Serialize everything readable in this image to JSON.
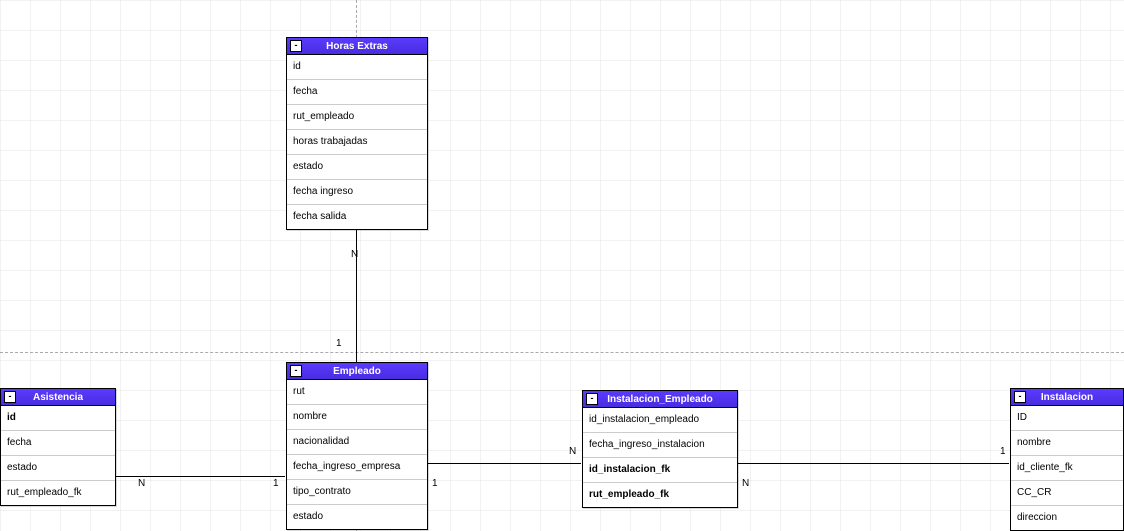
{
  "entities": {
    "horas_extras": {
      "title": "Horas Extras",
      "attrs": [
        "id",
        "fecha",
        "rut_empleado",
        "horas trabajadas",
        "estado",
        "fecha ingreso",
        "fecha salida"
      ]
    },
    "empleado": {
      "title": "Empleado",
      "attrs": [
        "rut",
        "nombre",
        "nacionalidad",
        "fecha_ingreso_empresa",
        "tipo_contrato",
        "estado"
      ]
    },
    "asistencia": {
      "title": "Asistencia",
      "attrs": [
        "id",
        "fecha",
        "estado",
        "rut_empleado_fk"
      ]
    },
    "instalacion_empleado": {
      "title": "Instalacion_Empleado",
      "attrs": [
        "id_instalacion_empleado",
        "fecha_ingreso_instalacion",
        "id_instalacion_fk",
        "rut_empleado_fk"
      ]
    },
    "instalacion": {
      "title": "Instalacion",
      "attrs": [
        "ID",
        "nombre",
        "id_cliente_fk",
        "CC_CR",
        "direccion"
      ]
    }
  },
  "cardinality": {
    "horas_n": "N",
    "horas_1": "1",
    "asistencia_n": "N",
    "asistencia_1": "1",
    "emp_ie_1": "1",
    "emp_ie_n": "N",
    "ie_inst_n": "N",
    "ie_inst_1": "1"
  },
  "relationships": [
    {
      "from": "horas_extras",
      "from_card": "N",
      "to": "empleado",
      "to_card": "1"
    },
    {
      "from": "asistencia",
      "from_card": "N",
      "to": "empleado",
      "to_card": "1"
    },
    {
      "from": "empleado",
      "from_card": "1",
      "to": "instalacion_empleado",
      "to_card": "N"
    },
    {
      "from": "instalacion_empleado",
      "from_card": "N",
      "to": "instalacion",
      "to_card": "1"
    }
  ],
  "colors": {
    "header": "#5a3cff",
    "grid": "#f0f0f0",
    "connector": "#000000"
  }
}
